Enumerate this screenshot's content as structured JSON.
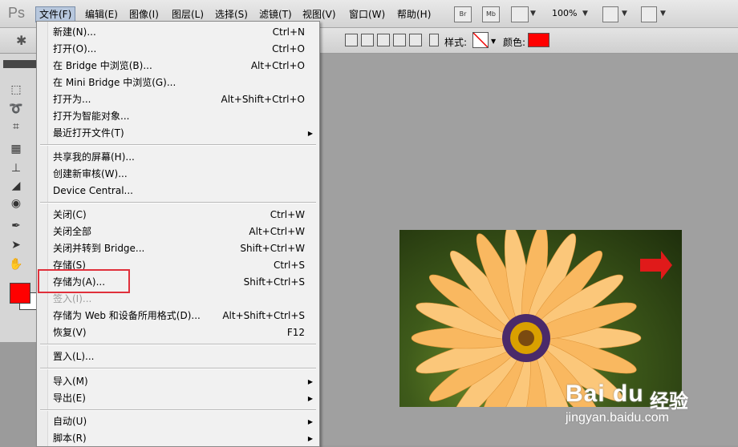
{
  "app": {
    "logo": "Ps"
  },
  "menubar": {
    "items": [
      "文件(F)",
      "编辑(E)",
      "图像(I)",
      "图层(L)",
      "选择(S)",
      "滤镜(T)",
      "视图(V)",
      "窗口(W)",
      "帮助(H)"
    ],
    "bridge_button": "Br",
    "minibridge_button": "Mb",
    "zoom": "100%"
  },
  "options_bar": {
    "style_label": "样式:",
    "color_label": "颜色:",
    "color_value": "#ff0000"
  },
  "tools": {
    "foreground_color": "#ff0000",
    "background_color": "#ffffff"
  },
  "file_menu": {
    "sections": [
      [
        {
          "label": "新建(N)...",
          "shortcut": "Ctrl+N"
        },
        {
          "label": "打开(O)...",
          "shortcut": "Ctrl+O"
        },
        {
          "label": "在 Bridge 中浏览(B)...",
          "shortcut": "Alt+Ctrl+O"
        },
        {
          "label": "在 Mini Bridge 中浏览(G)...",
          "shortcut": ""
        },
        {
          "label": "打开为...",
          "shortcut": "Alt+Shift+Ctrl+O"
        },
        {
          "label": "打开为智能对象...",
          "shortcut": ""
        },
        {
          "label": "最近打开文件(T)",
          "shortcut": "",
          "submenu": true
        }
      ],
      [
        {
          "label": "共享我的屏幕(H)...",
          "shortcut": ""
        },
        {
          "label": "创建新审核(W)...",
          "shortcut": ""
        },
        {
          "label": "Device Central...",
          "shortcut": ""
        }
      ],
      [
        {
          "label": "关闭(C)",
          "shortcut": "Ctrl+W"
        },
        {
          "label": "关闭全部",
          "shortcut": "Alt+Ctrl+W"
        },
        {
          "label": "关闭并转到 Bridge...",
          "shortcut": "Shift+Ctrl+W"
        },
        {
          "label": "存储(S)",
          "shortcut": "Ctrl+S"
        },
        {
          "label": "存储为(A)...",
          "shortcut": "Shift+Ctrl+S",
          "highlighted": true
        },
        {
          "label": "签入(I)...",
          "shortcut": "",
          "disabled": true
        },
        {
          "label": "存储为 Web 和设备所用格式(D)...",
          "shortcut": "Alt+Shift+Ctrl+S"
        },
        {
          "label": "恢复(V)",
          "shortcut": "F12"
        }
      ],
      [
        {
          "label": "置入(L)...",
          "shortcut": ""
        }
      ],
      [
        {
          "label": "导入(M)",
          "shortcut": "",
          "submenu": true
        },
        {
          "label": "导出(E)",
          "shortcut": "",
          "submenu": true
        }
      ],
      [
        {
          "label": "自动(U)",
          "shortcut": "",
          "submenu": true
        },
        {
          "label": "脚本(R)",
          "shortcut": "",
          "submenu": true
        }
      ]
    ]
  },
  "watermark": {
    "brand": "Bai du",
    "sub": "经验",
    "url": "jingyan.baidu.com"
  }
}
